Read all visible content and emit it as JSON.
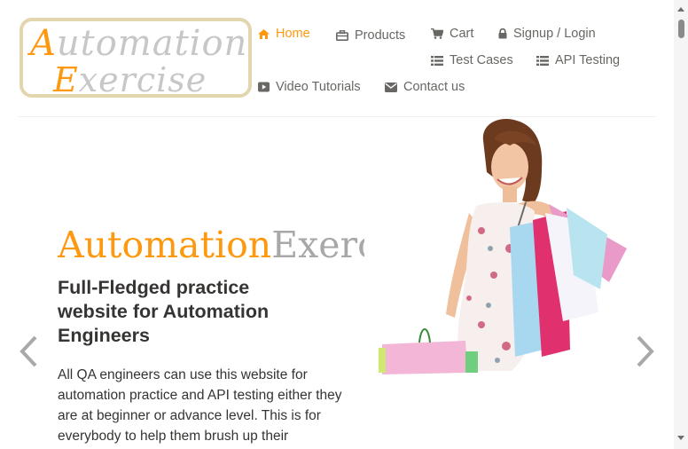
{
  "logo": {
    "line1_first": "A",
    "line1_rest": "utomation",
    "line2_first": "E",
    "line2_rest": "xercise"
  },
  "nav": {
    "home": "Home",
    "products": "Products",
    "cart": "Cart",
    "signup_login": "Signup / Login",
    "test_cases": "Test Cases",
    "api_testing": "API Testing",
    "video_tutorials": "Video Tutorials",
    "contact_us": "Contact us"
  },
  "hero": {
    "brand_part1": "Automation",
    "brand_part2": "Exercise",
    "title": "Full-Fledged practice website for Automation Engineers",
    "description": "All QA engineers can use this website for automation practice and API testing either they are at beginner or advance level. This is for everybody to help them brush up their"
  },
  "colors": {
    "accent": "#fe980f",
    "text": "#696763",
    "dark_text": "#363432"
  },
  "icons": {
    "home": "home-icon",
    "products": "briefcase-icon",
    "cart": "cart-icon",
    "login": "lock-icon",
    "test_cases": "list-icon",
    "api": "list-icon",
    "video": "youtube-play-icon",
    "contact": "envelope-icon",
    "prev": "chevron-left-icon",
    "next": "chevron-right-icon"
  }
}
